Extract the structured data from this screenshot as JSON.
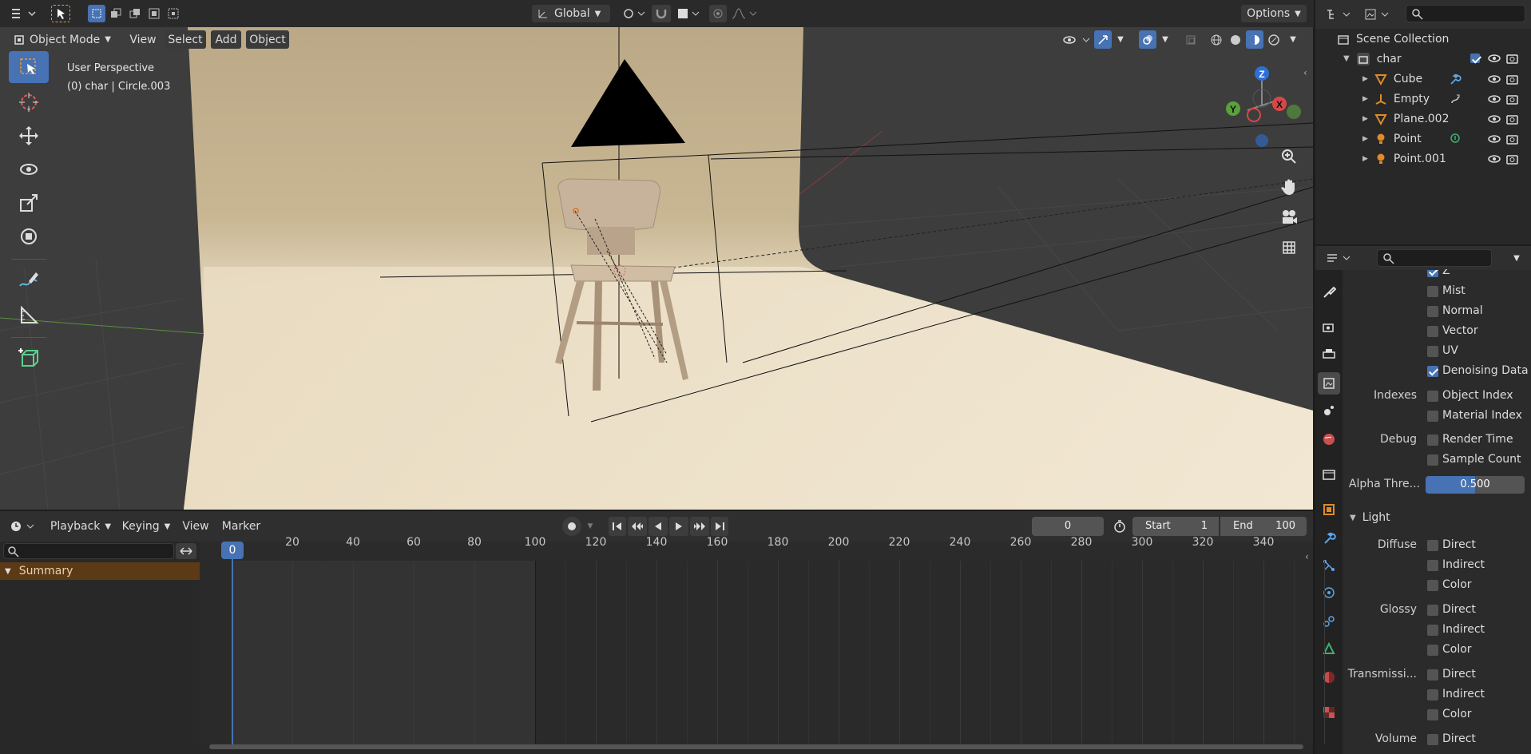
{
  "topbar": {
    "orientation_label": "Global",
    "options_label": "Options"
  },
  "viewport_header": {
    "mode_label": "Object Mode",
    "menu": [
      "View",
      "Select",
      "Add",
      "Object"
    ]
  },
  "viewport": {
    "perspective_label": "User Perspective",
    "object_label": "(0) char | Circle.003",
    "gizmo_axes": [
      "Z",
      "Y",
      "X"
    ]
  },
  "outliner": {
    "root": "Scene Collection",
    "collection": "char",
    "items": [
      {
        "label": "Cube",
        "icon": "mesh-icon",
        "extra": "wrench-icon"
      },
      {
        "label": "Empty",
        "icon": "empty-icon",
        "extra": "constraint-icon"
      },
      {
        "label": "Plane.002",
        "icon": "mesh-icon",
        "extra": ""
      },
      {
        "label": "Point",
        "icon": "light-icon",
        "extra": "light-data-icon"
      },
      {
        "label": "Point.001",
        "icon": "light-icon",
        "extra": ""
      }
    ]
  },
  "properties": {
    "rows": [
      {
        "section": "",
        "label": "Z",
        "checked": true
      },
      {
        "section": "",
        "label": "Mist",
        "checked": false
      },
      {
        "section": "",
        "label": "Normal",
        "checked": false
      },
      {
        "section": "",
        "label": "Vector",
        "checked": false
      },
      {
        "section": "",
        "label": "UV",
        "checked": false
      },
      {
        "section": "",
        "label": "Denoising Data",
        "checked": true
      },
      {
        "section": "Indexes",
        "label": "Object Index",
        "checked": false
      },
      {
        "section": "",
        "label": "Material Index",
        "checked": false
      },
      {
        "section": "Debug",
        "label": "Render Time",
        "checked": false
      },
      {
        "section": "",
        "label": "Sample Count",
        "checked": false
      }
    ],
    "alpha_label": "Alpha Thre...",
    "alpha_value": "0.500",
    "alpha_fraction": 0.5,
    "light_panel": "Light",
    "light_rows": [
      {
        "section": "Diffuse",
        "label": "Direct",
        "checked": false
      },
      {
        "section": "",
        "label": "Indirect",
        "checked": false
      },
      {
        "section": "",
        "label": "Color",
        "checked": false
      },
      {
        "section": "Glossy",
        "label": "Direct",
        "checked": false
      },
      {
        "section": "",
        "label": "Indirect",
        "checked": false
      },
      {
        "section": "",
        "label": "Color",
        "checked": false
      },
      {
        "section": "Transmissi...",
        "label": "Direct",
        "checked": false
      },
      {
        "section": "",
        "label": "Indirect",
        "checked": false
      },
      {
        "section": "",
        "label": "Color",
        "checked": false
      },
      {
        "section": "Volume",
        "label": "Direct",
        "checked": false
      }
    ]
  },
  "timeline": {
    "menu": [
      "Playback",
      "Keying",
      "View",
      "Marker"
    ],
    "current_frame": "0",
    "start_label": "Start",
    "start_value": "1",
    "end_label": "End",
    "end_value": "100",
    "playhead_label": "0",
    "ticks": [
      "20",
      "40",
      "60",
      "80",
      "100",
      "120",
      "140",
      "160",
      "180",
      "200",
      "220",
      "240",
      "260",
      "280",
      "300",
      "320",
      "340"
    ],
    "summary_label": "Summary"
  },
  "colors": {
    "accent": "#4772b3",
    "backdrop_top": "#b8a482",
    "backdrop_floor": "#ece0c8",
    "summary": "#5c3a16"
  }
}
